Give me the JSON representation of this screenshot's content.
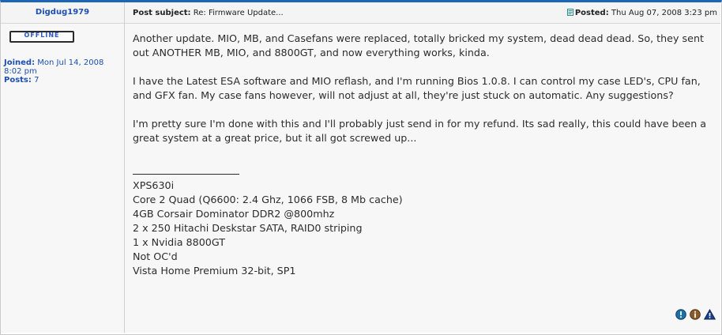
{
  "author": {
    "username": "Digdug1979",
    "status": "OFFLINE",
    "joined_label": "Joined:",
    "joined_value": "Mon Jul 14, 2008 8:02 pm",
    "posts_label": "Posts:",
    "posts_value": "7"
  },
  "header": {
    "subject_label": "Post subject:",
    "subject_value": "Re: Firmware Update...",
    "posted_label": "Posted:",
    "posted_value": "Thu Aug 07, 2008 3:23 pm"
  },
  "body": {
    "paragraphs": [
      "Another update. MIO, MB, and Casefans were replaced, totally bricked my system, dead dead dead. So, they sent out ANOTHER MB, MIO, and 8800GT, and now everything works, kinda.",
      "I have the Latest ESA software and MIO reflash, and I'm running Bios 1.0.8. I can control my case LED's, CPU fan, and GFX fan. My case fans however, will not adjust at all, they're just stuck on automatic. Any suggestions?",
      "I'm pretty sure I'm done with this and I'll probably just send in for my refund. Its sad really, this could have been a great system at a great price, but it all got screwed up..."
    ],
    "signature": [
      "XPS630i",
      "Core 2 Quad (Q6600: 2.4 Ghz, 1066 FSB, 8 Mb cache)",
      "4GB Corsair Dominator DDR2 @800mhz",
      "2 x 250 Hitachi Deskstar SATA, RAID0 striping",
      "1 x Nvidia 8800GT",
      "Not OC'd",
      "Vista Home Premium 32-bit, SP1"
    ]
  },
  "actions": {
    "icons": [
      "report-icon",
      "info-icon",
      "warning-icon"
    ],
    "colors": {
      "report": "#1e6fa8",
      "info": "#8a5a2b",
      "warning": "#1a3f8f"
    }
  },
  "colors": {
    "accent": "#1d65b5",
    "link": "#1d4fb0"
  }
}
